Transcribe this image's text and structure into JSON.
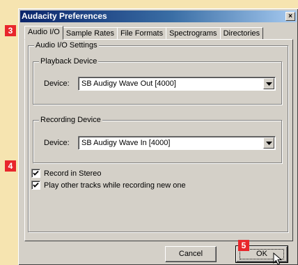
{
  "window": {
    "title": "Audacity Preferences",
    "close_glyph": "×"
  },
  "tabs": [
    {
      "label": "Audio I/O",
      "active": true
    },
    {
      "label": "Sample Rates",
      "active": false
    },
    {
      "label": "File Formats",
      "active": false
    },
    {
      "label": "Spectrograms",
      "active": false
    },
    {
      "label": "Directories",
      "active": false
    }
  ],
  "panel": {
    "title": "Audio I/O Settings",
    "playback": {
      "title": "Playback Device",
      "device_label": "Device:",
      "device_value": "SB Audigy Wave Out [4000]"
    },
    "recording": {
      "title": "Recording Device",
      "device_label": "Device:",
      "device_value": "SB Audigy Wave In [4000]"
    },
    "options": [
      {
        "label": "Record in Stereo",
        "checked": true
      },
      {
        "label": "Play other tracks while recording new one",
        "checked": true
      }
    ]
  },
  "buttons": {
    "cancel": "Cancel",
    "ok": "OK"
  },
  "annotations": {
    "tabs_marker": "3",
    "options_marker": "4",
    "ok_marker": "5",
    "marker_color": "#e8262b"
  }
}
